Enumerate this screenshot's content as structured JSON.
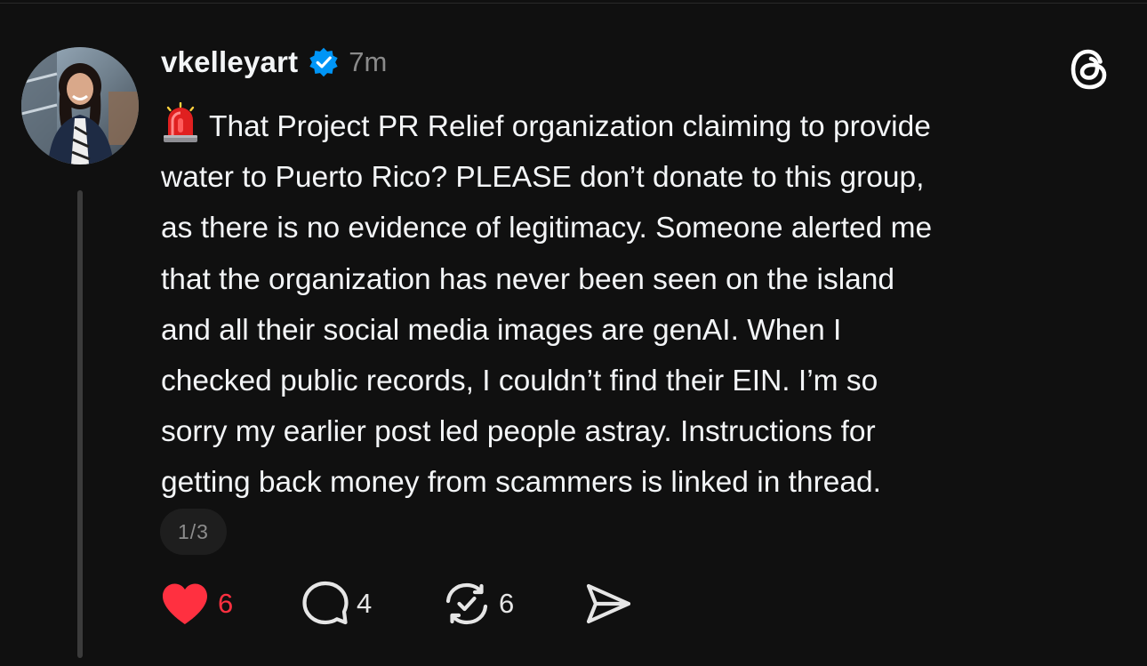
{
  "post": {
    "username": "vkelleyart",
    "timestamp": "7m",
    "body_lines": [
      "That Project PR Relief organization claiming to provide",
      "water to Puerto Rico? PLEASE don’t donate to this group,",
      "as there is no evidence of legitimacy. Someone alerted me",
      "that the organization has never been seen on the island",
      "and all their social media images are genAI. When I",
      "checked public records, I couldn’t find their EIN. I’m so",
      "sorry my earlier post led people astray. Instructions for",
      "getting back money from scammers is linked in thread."
    ],
    "page_indicator": "1/3"
  },
  "actions": {
    "like_count": "6",
    "reply_count": "4",
    "repost_count": "6"
  },
  "icons": {
    "badge": "verified-badge-icon",
    "siren": "siren-emoji-icon",
    "app_logo": "threads-logo-icon",
    "like": "heart-icon",
    "reply": "comment-bubble-icon",
    "repost": "repost-icon",
    "share": "send-icon"
  },
  "colors": {
    "background": "#101010",
    "verified": "#0095f6",
    "like": "#ff3040",
    "secondary_text": "#8a8a8a"
  }
}
